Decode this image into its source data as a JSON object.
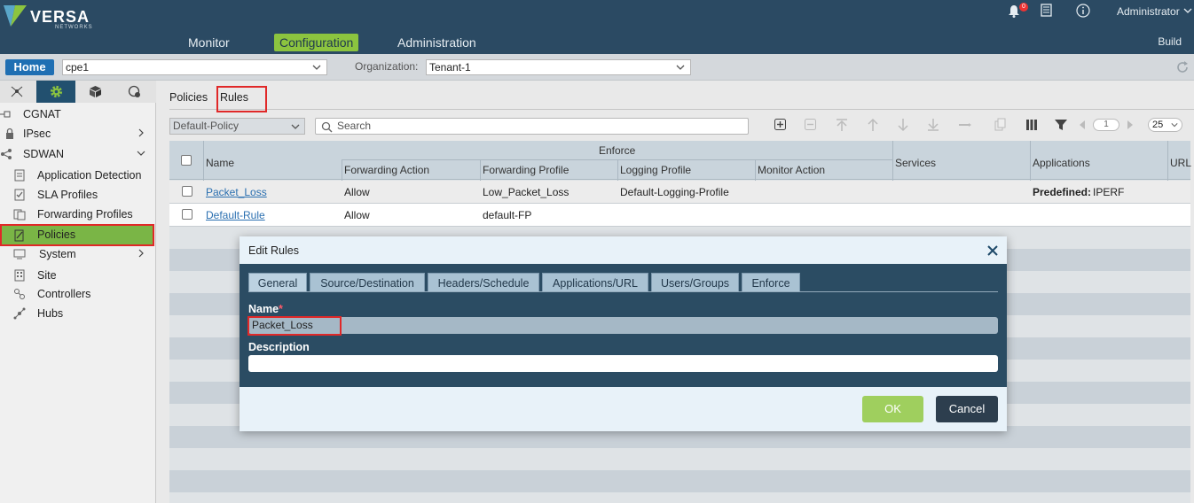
{
  "header": {
    "brand": "VERSA",
    "brand_sub": "NETWORKS",
    "nav": [
      "Monitor",
      "Configuration",
      "Administration"
    ],
    "notifications_count": "0",
    "user": "Administrator",
    "build_label": "Build",
    "accent_color": "#8cc43f"
  },
  "subbar": {
    "home_label": "Home",
    "device_value": "cpe1",
    "org_label": "Organization:",
    "org_value": "Tenant-1"
  },
  "sidebar": {
    "items": [
      {
        "label": "CGNAT",
        "icon": "cgnat-icon"
      },
      {
        "label": "IPsec",
        "icon": "ipsec-icon"
      },
      {
        "label": "SDWAN",
        "icon": "sdwan-icon"
      },
      {
        "label": "Application Detection",
        "icon": "app-detection-icon"
      },
      {
        "label": "SLA Profiles",
        "icon": "sla-icon"
      },
      {
        "label": "Forwarding Profiles",
        "icon": "forwarding-icon"
      },
      {
        "label": "Policies",
        "icon": "policies-icon"
      },
      {
        "label": "System",
        "icon": "system-icon"
      },
      {
        "label": "Site",
        "icon": "site-icon"
      },
      {
        "label": "Controllers",
        "icon": "controllers-icon"
      },
      {
        "label": "Hubs",
        "icon": "hubs-icon"
      }
    ]
  },
  "main": {
    "tabs": [
      "Policies",
      "Rules"
    ],
    "policy_select": "Default-Policy",
    "search_placeholder": "Search",
    "page_number": "1",
    "page_size": "25",
    "columns": {
      "name": "Name",
      "enforce": "Enforce",
      "forwarding_action": "Forwarding Action",
      "forwarding_profile": "Forwarding Profile",
      "logging_profile": "Logging Profile",
      "monitor_action": "Monitor Action",
      "services": "Services",
      "applications": "Applications",
      "url": "URL"
    },
    "rows": [
      {
        "name": "Packet_Loss",
        "forwarding_action": "Allow",
        "forwarding_profile": "Low_Packet_Loss",
        "logging_profile": "Default-Logging-Profile",
        "monitor_action": "",
        "services": "",
        "applications_prefix": "Predefined:",
        "applications_value": "IPERF"
      },
      {
        "name": "Default-Rule",
        "forwarding_action": "Allow",
        "forwarding_profile": "default-FP",
        "logging_profile": "",
        "monitor_action": "",
        "services": "",
        "applications_prefix": "",
        "applications_value": ""
      }
    ]
  },
  "modal": {
    "title": "Edit Rules",
    "tabs": [
      "General",
      "Source/Destination",
      "Headers/Schedule",
      "Applications/URL",
      "Users/Groups",
      "Enforce"
    ],
    "name_label": "Name",
    "name_required": "*",
    "name_value": "Packet_Loss",
    "description_label": "Description",
    "description_value": "",
    "ok_label": "OK",
    "cancel_label": "Cancel"
  }
}
